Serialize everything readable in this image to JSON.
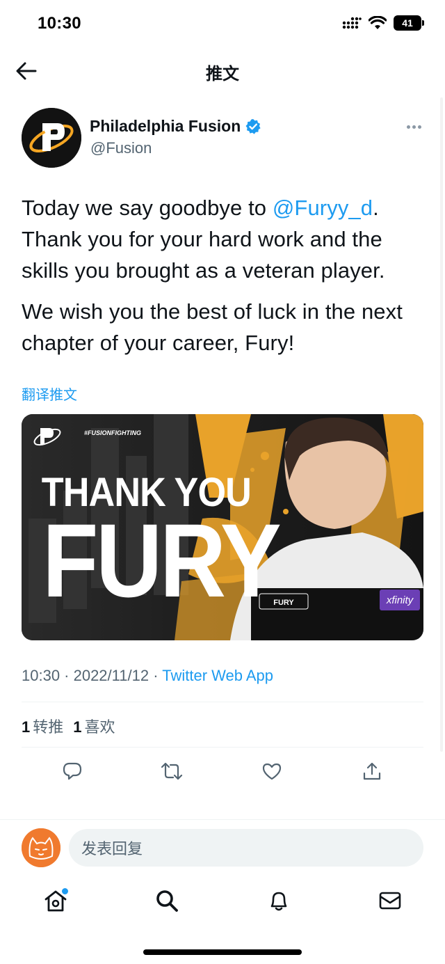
{
  "status_bar": {
    "time": "10:30",
    "battery": "41"
  },
  "header": {
    "title": "推文",
    "back_icon": "arrow-left-icon"
  },
  "tweet": {
    "author_name": "Philadelphia Fusion",
    "author_handle": "@Fusion",
    "verified": true,
    "text_line1_pre": "Today we say goodbye to ",
    "mention": "@Furyy_d",
    "text_line1_post": ". Thank you for your hard work and the skills you brought as a veteran player.",
    "text_para2": "We wish you the best of luck in the next chapter of your career, Fury!",
    "translate_label": "翻译推文",
    "media": {
      "hashtag": "#FUSIONFIGHTING",
      "headline1": "THANK YOU",
      "headline2": "FURY",
      "jersey_name": "FURY",
      "sponsor": "xfinity"
    },
    "timestamp": "10:30 · 2022/11/12 · ",
    "source": "Twitter Web App",
    "retweet_count": "1",
    "retweet_label": "转推",
    "like_count": "1",
    "like_label": "喜欢"
  },
  "reply": {
    "placeholder": "发表回复"
  },
  "colors": {
    "accent": "#1d9bf0",
    "secondary_text": "#536471",
    "fusion_orange": "#f5a623"
  }
}
